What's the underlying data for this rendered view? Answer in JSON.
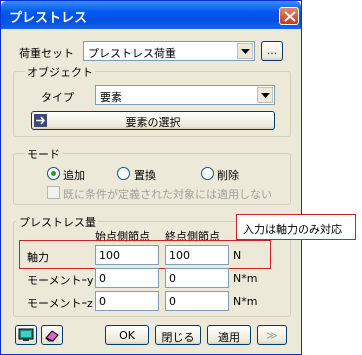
{
  "window": {
    "title": "プレストレス"
  },
  "load_set": {
    "label": "荷重セット",
    "value": "プレストレス荷重",
    "browse_label": "..."
  },
  "object_group": {
    "title": "オブジェクト",
    "type_label": "タイプ",
    "type_value": "要素",
    "select_button": "要素の選択"
  },
  "mode_group": {
    "title": "モード",
    "options": [
      "追加",
      "置換",
      "削除"
    ],
    "selected": "追加",
    "checkbox_label": "既に条件が定義された対象には適用しない"
  },
  "prestress_group": {
    "title": "プレストレス量",
    "col_start": "始点側節点",
    "col_end": "終点側節点",
    "rows": [
      {
        "label": "軸力",
        "start": "100",
        "end": "100",
        "unit": "N"
      },
      {
        "label": "モーメントｰy",
        "start": "0",
        "end": "0",
        "unit": "N*m"
      },
      {
        "label": "モーメントｰz",
        "start": "0",
        "end": "0",
        "unit": "N*m"
      }
    ]
  },
  "buttons": {
    "ok": "OK",
    "close": "閉じる",
    "apply": "適用",
    "expand": "≫"
  },
  "annotation": {
    "text": "入力は軸力のみ対応"
  },
  "colors": {
    "titlebar": "#0058ee",
    "window_bg": "#ece9d8",
    "annotation_border": "#cc2222"
  }
}
